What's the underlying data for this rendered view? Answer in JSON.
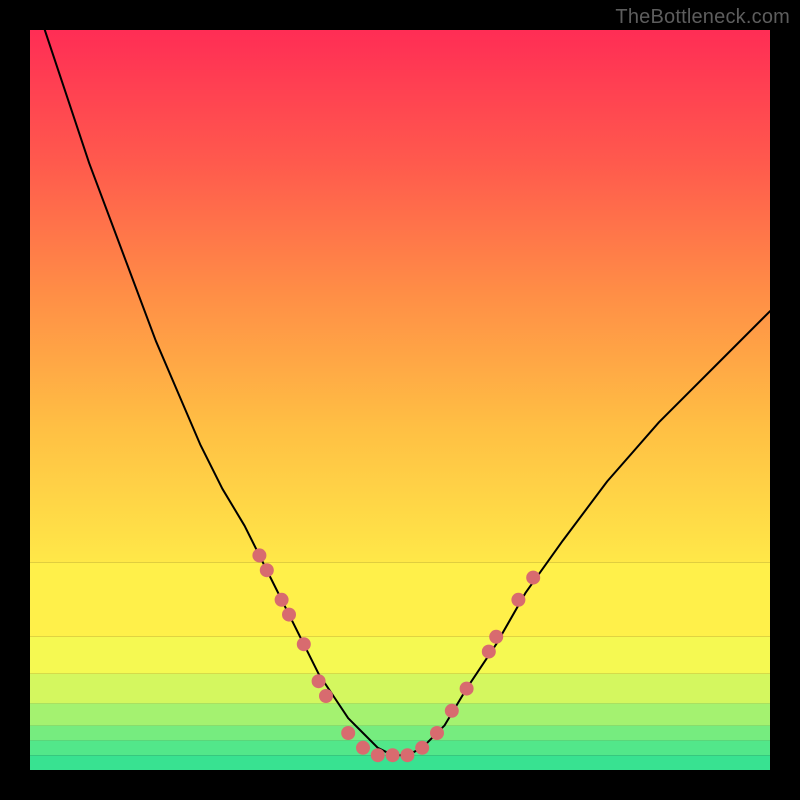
{
  "watermark": "TheBottleneck.com",
  "chart_data": {
    "type": "line",
    "title": "",
    "xlabel": "",
    "ylabel": "",
    "xlim": [
      0,
      100
    ],
    "ylim": [
      0,
      100
    ],
    "grid": false,
    "series": [
      {
        "name": "bottleneck-curve",
        "x": [
          2,
          5,
          8,
          11,
          14,
          17,
          20,
          23,
          26,
          29,
          31,
          33,
          35,
          37,
          39,
          41,
          43,
          45,
          47,
          49,
          51,
          53,
          56,
          59,
          63,
          67,
          72,
          78,
          85,
          93,
          100
        ],
        "y": [
          100,
          91,
          82,
          74,
          66,
          58,
          51,
          44,
          38,
          33,
          29,
          25,
          21,
          17,
          13,
          10,
          7,
          5,
          3,
          2,
          2,
          3,
          6,
          11,
          17,
          24,
          31,
          39,
          47,
          55,
          62
        ],
        "stroke": "#000000",
        "stroke_width": 2
      }
    ],
    "scatter_points": {
      "name": "datapoints",
      "color": "#d86b6f",
      "radius": 7,
      "points": [
        {
          "x": 31,
          "y": 29
        },
        {
          "x": 32,
          "y": 27
        },
        {
          "x": 34,
          "y": 23
        },
        {
          "x": 35,
          "y": 21
        },
        {
          "x": 37,
          "y": 17
        },
        {
          "x": 39,
          "y": 12
        },
        {
          "x": 40,
          "y": 10
        },
        {
          "x": 43,
          "y": 5
        },
        {
          "x": 45,
          "y": 3
        },
        {
          "x": 47,
          "y": 2
        },
        {
          "x": 49,
          "y": 2
        },
        {
          "x": 51,
          "y": 2
        },
        {
          "x": 53,
          "y": 3
        },
        {
          "x": 55,
          "y": 5
        },
        {
          "x": 57,
          "y": 8
        },
        {
          "x": 59,
          "y": 11
        },
        {
          "x": 62,
          "y": 16
        },
        {
          "x": 63,
          "y": 18
        },
        {
          "x": 66,
          "y": 23
        },
        {
          "x": 68,
          "y": 26
        }
      ]
    },
    "background_bands": [
      {
        "y0": 0,
        "y1": 2,
        "color": "#38e291"
      },
      {
        "y0": 2,
        "y1": 4,
        "color": "#52e78a"
      },
      {
        "y0": 4,
        "y1": 6,
        "color": "#76ec7f"
      },
      {
        "y0": 6,
        "y1": 9,
        "color": "#a4f270"
      },
      {
        "y0": 9,
        "y1": 13,
        "color": "#d4f75f"
      },
      {
        "y0": 13,
        "y1": 18,
        "color": "#f5f952"
      },
      {
        "y0": 18,
        "y1": 28,
        "color": "#fff04a"
      }
    ],
    "background_gradient": {
      "from_y": 28,
      "to_y": 100,
      "stops": [
        {
          "offset": 0.0,
          "color": "#ffe848"
        },
        {
          "offset": 0.25,
          "color": "#ffc044"
        },
        {
          "offset": 0.5,
          "color": "#ff8f46"
        },
        {
          "offset": 0.75,
          "color": "#ff5a4d"
        },
        {
          "offset": 1.0,
          "color": "#ff2d55"
        }
      ]
    }
  }
}
